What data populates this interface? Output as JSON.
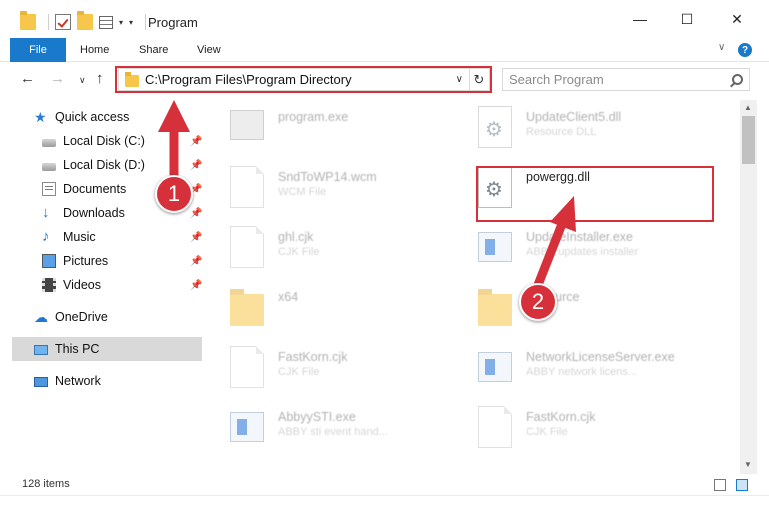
{
  "window": {
    "title": "Program",
    "controls": {
      "minimize": "—",
      "maximize": "☐",
      "close": "✕"
    }
  },
  "ribbon": {
    "tabs": [
      "File",
      "Home",
      "Share",
      "View"
    ],
    "help": "?"
  },
  "nav": {
    "address": "C:\\Program Files\\Program Directory",
    "search_placeholder": "Search Program"
  },
  "sidebar": {
    "items": [
      {
        "label": "Quick access",
        "icon": "star-icon",
        "pinned": false
      },
      {
        "label": "Local Disk (C:)",
        "icon": "disk-icon",
        "pinned": true
      },
      {
        "label": "Local Disk (D:)",
        "icon": "disk-icon",
        "pinned": true
      },
      {
        "label": "Documents",
        "icon": "documents-icon",
        "pinned": true
      },
      {
        "label": "Downloads",
        "icon": "download-icon",
        "pinned": true
      },
      {
        "label": "Music",
        "icon": "music-icon",
        "pinned": true
      },
      {
        "label": "Pictures",
        "icon": "pictures-icon",
        "pinned": true
      },
      {
        "label": "Videos",
        "icon": "videos-icon",
        "pinned": true
      },
      {
        "label": "OneDrive",
        "icon": "cloud-icon",
        "pinned": false
      },
      {
        "label": "This PC",
        "icon": "computer-icon",
        "pinned": false,
        "selected": true
      },
      {
        "label": "Network",
        "icon": "network-icon",
        "pinned": false
      }
    ]
  },
  "files": [
    {
      "name": "program.exe",
      "desc": "",
      "icon": "exe-icon"
    },
    {
      "name": "UpdateClient5.dll",
      "desc": "Resource DLL",
      "icon": "gear-file-icon"
    },
    {
      "name": "SndToWP14.wcm",
      "desc": "WCM File",
      "icon": "document-icon"
    },
    {
      "name": "powergg.dll",
      "desc": "",
      "icon": "gear-file-icon",
      "highlighted": true
    },
    {
      "name": "ghl.cjk",
      "desc": "CJK File",
      "icon": "document-icon"
    },
    {
      "name": "UpdateInstaller.exe",
      "desc": "ABBY updates installer",
      "icon": "window-icon"
    },
    {
      "name": "x64",
      "desc": "",
      "icon": "folder-icon"
    },
    {
      "name": "Resource",
      "desc": "",
      "icon": "folder-icon"
    },
    {
      "name": "FastKorn.cjk",
      "desc": "CJK File",
      "icon": "document-icon"
    },
    {
      "name": "NetworkLicenseServer.exe",
      "desc": "ABBY network licens...",
      "icon": "window-icon"
    },
    {
      "name": "AbbyySTI.exe",
      "desc": "ABBY sti event hand...",
      "icon": "window-icon"
    },
    {
      "name": "FastKorn.cjk",
      "desc": "CJK File",
      "icon": "document-icon"
    }
  ],
  "status": {
    "count": "128 items"
  },
  "annotations": {
    "step1": "1",
    "step2": "2",
    "color": "#d6313a"
  }
}
